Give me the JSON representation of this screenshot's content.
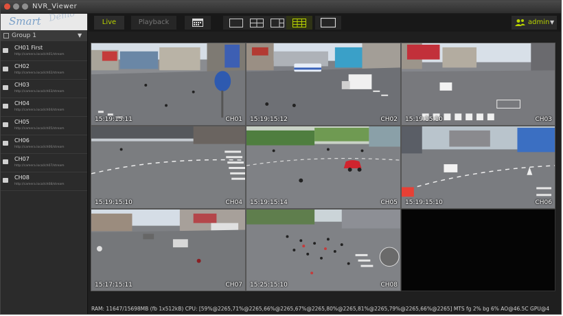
{
  "window": {
    "title": "NVR_Viewer"
  },
  "logo": {
    "text": "Smart",
    "watermark": "Demo"
  },
  "toolbar": {
    "live_label": "Live",
    "playback_label": "Playback",
    "user": "admin",
    "accent": "#b8d200"
  },
  "sidebar": {
    "group_label": "Group 1",
    "channels": [
      {
        "name": "CH01  First",
        "url": "http://camera.local/ch01/stream"
      },
      {
        "name": "CH02",
        "url": "http://camera.local/ch02/stream"
      },
      {
        "name": "CH03",
        "url": "http://camera.local/ch03/stream"
      },
      {
        "name": "CH04",
        "url": "http://camera.local/ch04/stream"
      },
      {
        "name": "CH05",
        "url": "http://camera.local/ch05/stream"
      },
      {
        "name": "CH06",
        "url": "http://camera.local/ch06/stream"
      },
      {
        "name": "CH07",
        "url": "http://camera.local/ch07/stream"
      },
      {
        "name": "CH08",
        "url": "http://camera.local/ch08/stream"
      }
    ]
  },
  "cameras": [
    {
      "time": "15:19:15:11",
      "label": "CH01"
    },
    {
      "time": "15:19:15:12",
      "label": "CH02"
    },
    {
      "time": "15:19:15:10",
      "label": "CH03"
    },
    {
      "time": "15:19:15:10",
      "label": "CH04"
    },
    {
      "time": "15:19:15:14",
      "label": "CH05"
    },
    {
      "time": "15:19:15:10",
      "label": "CH06"
    },
    {
      "time": "15:17:15:11",
      "label": "CH07"
    },
    {
      "time": "15:25:15:10",
      "label": "CH08"
    }
  ],
  "status": {
    "text": "RAM: 11647/15698MB (fb 1x512kB) CPU: [59%@2265,71%@2265,66%@2265,67%@2265,80%@2265,81%@2265,79%@2265,66%@2265] MTS fg 2% bg 6% AO@46.5C GPU@4"
  }
}
